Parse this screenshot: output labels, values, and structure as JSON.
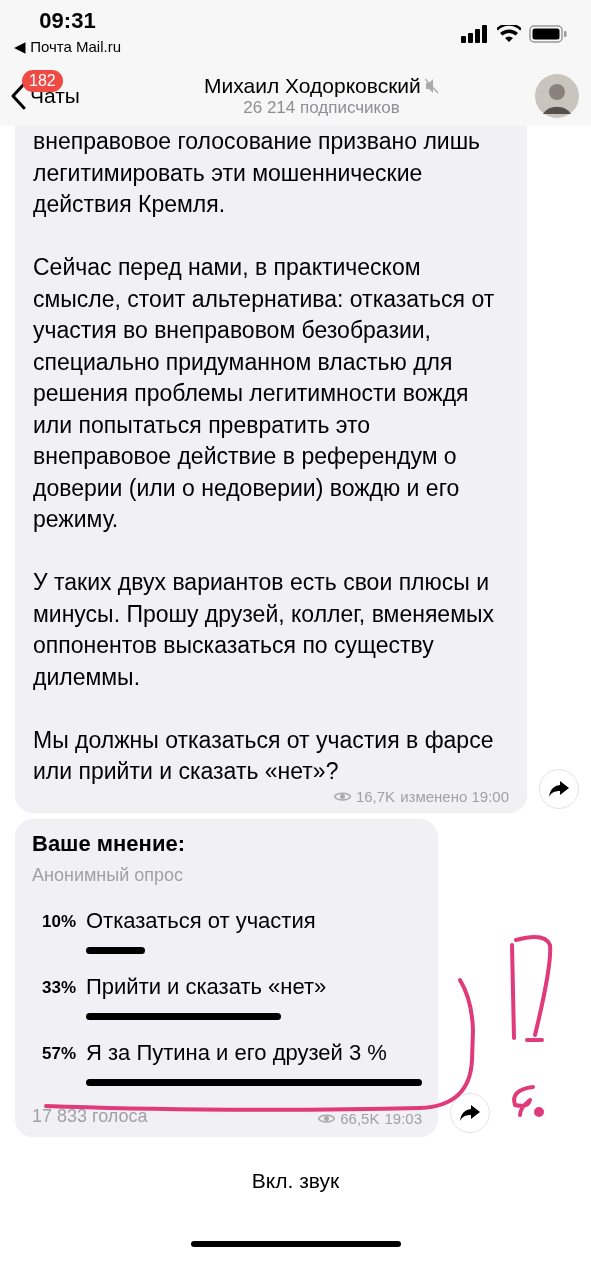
{
  "status_bar": {
    "time": "09:31",
    "back_app": "◀ Почта Mail.ru"
  },
  "header": {
    "back_label": "Чаты",
    "unread_badge": "182",
    "title": "Михаил Ходорковский",
    "muted": true,
    "subtitle": "26 214 подписчиков"
  },
  "post": {
    "paragraphs": [
      "внеправовое голосование призвано лишь легитимировать эти мошеннические действия Кремля.",
      "Сейчас перед нами, в практическом смысле, стоит альтернатива: отказаться от участия во внеправовом безобразии, специально придуманном властью для решения проблемы легитимности вождя или попытаться превратить это внеправовое действие в референдум о доверии (или о недоверии) вождю и его режиму.",
      "У таких двух вариантов есть свои плюсы и минусы. Прошу друзей, коллег, вменяемых оппонентов высказаться по существу дилеммы.",
      "Мы должны отказаться от участия в фарсе или прийти и сказать «нет»?"
    ],
    "views": "16,7K",
    "meta": "изменено 19:00"
  },
  "poll": {
    "question": "Ваше мнение:",
    "type": "Анонимный опрос",
    "options": [
      {
        "percent": "10%",
        "label": "Отказаться от участия"
      },
      {
        "percent": "33%",
        "label": "Прийти и сказать «нет»"
      },
      {
        "percent": "57%",
        "label": "Я за Путина и его друзей 3 %"
      }
    ],
    "votes": "17 833 голоса",
    "views": "66,5K",
    "time": "19:03"
  },
  "footer": {
    "sound_button": "Вкл. звук"
  }
}
